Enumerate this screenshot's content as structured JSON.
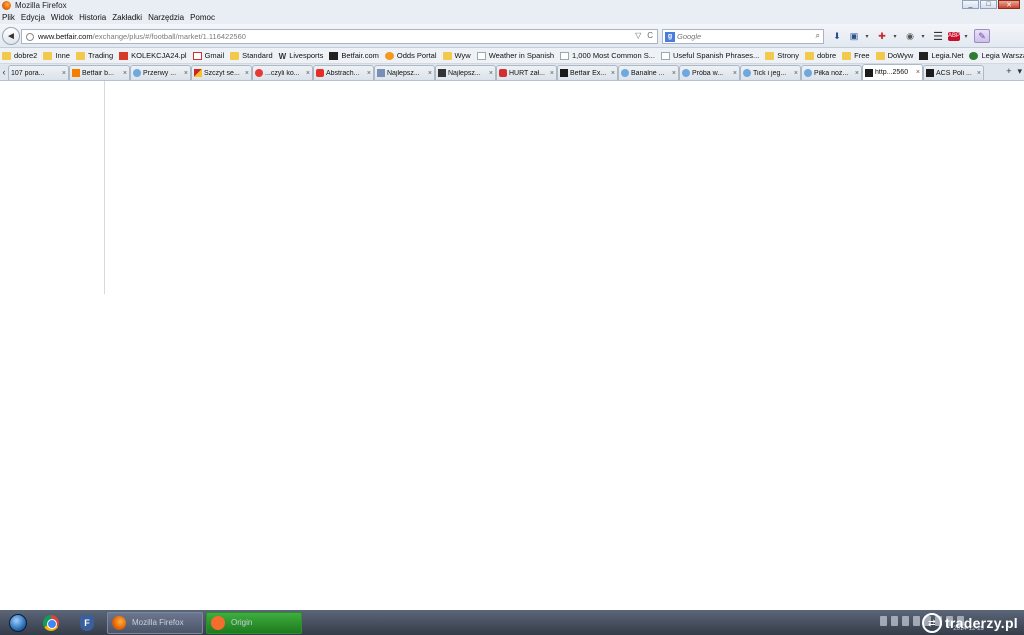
{
  "window": {
    "title": "Mozilla Firefox",
    "controls": {
      "minimize": "_",
      "maximize": "□",
      "close": "✕"
    }
  },
  "menubar": [
    "Plik",
    "Edycja",
    "Widok",
    "Historia",
    "Zakładki",
    "Narzędzia",
    "Pomoc"
  ],
  "navbar": {
    "back": "◄",
    "url_host": "www.betfair.com",
    "url_path": "/exchange/plus/#/football/market/1.116422560",
    "url_dropdown": "▽",
    "reload": "C",
    "search_placeholder": "Google",
    "search_engine": "g",
    "search_go": "⌕"
  },
  "toolbar_icons": [
    {
      "name": "download-icon",
      "glyph": "⬇"
    },
    {
      "name": "save-icon",
      "glyph": "▣"
    },
    {
      "name": "addon-icon",
      "glyph": "✚"
    },
    {
      "name": "web-of-trust-icon",
      "glyph": "◉"
    },
    {
      "name": "menu-icon",
      "glyph": "☰"
    },
    {
      "name": "adblock-icon",
      "glyph": "ABP"
    },
    {
      "name": "pen-icon",
      "glyph": "✎"
    }
  ],
  "bookmarks": [
    {
      "label": "dobre2",
      "icon": "folder"
    },
    {
      "label": "Inne",
      "icon": "folder"
    },
    {
      "label": "Trading",
      "icon": "folder"
    },
    {
      "label": "KOLEKCJA24.pl",
      "icon": "red"
    },
    {
      "label": "Gmail",
      "icon": "gmail"
    },
    {
      "label": "Standard",
      "icon": "folder"
    },
    {
      "label": "Livesports",
      "icon": "w"
    },
    {
      "label": "Betfair.com",
      "icon": "dark"
    },
    {
      "label": "Odds Portal",
      "icon": "orange"
    },
    {
      "label": "Wyw",
      "icon": "folder"
    },
    {
      "label": "Weather in Spanish",
      "icon": "page"
    },
    {
      "label": "1,000 Most Common S...",
      "icon": "page"
    },
    {
      "label": "Useful Spanish Phrases...",
      "icon": "page"
    },
    {
      "label": "Strony",
      "icon": "folder"
    },
    {
      "label": "dobre",
      "icon": "folder"
    },
    {
      "label": "Free",
      "icon": "folder"
    },
    {
      "label": "DoWyw",
      "icon": "folder"
    },
    {
      "label": "Legia.Net",
      "icon": "dark"
    },
    {
      "label": "Legia Warszawa",
      "icon": "green"
    }
  ],
  "tabs": [
    {
      "label": "107 pora...",
      "icon": "none",
      "active": false
    },
    {
      "label": "Betfair b...",
      "icon": "blogger",
      "active": false
    },
    {
      "label": "Przerwy ...",
      "icon": "cloud",
      "active": false
    },
    {
      "label": "Szczyt se...",
      "icon": "pencil",
      "active": false
    },
    {
      "label": "...czyli ko...",
      "icon": "plane",
      "active": false
    },
    {
      "label": "Abstrach...",
      "icon": "yt",
      "active": false
    },
    {
      "label": "Najlepsz...",
      "icon": "img",
      "active": false
    },
    {
      "label": "Najlepsz...",
      "icon": "dark2",
      "active": false
    },
    {
      "label": "HURT zał...",
      "icon": "hurt",
      "active": false
    },
    {
      "label": "Betfair Ex...",
      "icon": "bf",
      "active": false
    },
    {
      "label": "Banalne ...",
      "icon": "cloud",
      "active": false
    },
    {
      "label": "Próba w...",
      "icon": "cloud",
      "active": false
    },
    {
      "label": "Tick i jeg...",
      "icon": "cloud",
      "active": false
    },
    {
      "label": "Piłka noż...",
      "icon": "cloud",
      "active": false
    },
    {
      "label": "http...2560",
      "icon": "bf",
      "active": true
    },
    {
      "label": "ACS Poli ...",
      "icon": "bf",
      "active": false
    }
  ],
  "tab_close": "×",
  "tab_controls": {
    "scroll_left": "‹",
    "new_tab": "+",
    "list": "▾"
  },
  "taskbar": {
    "tasks": [
      {
        "label": "Mozilla Firefox",
        "style": "ff"
      },
      {
        "label": "Origin",
        "style": "origin"
      }
    ],
    "clock": "2014-12-29"
  },
  "watermark": "traderzy.pl"
}
